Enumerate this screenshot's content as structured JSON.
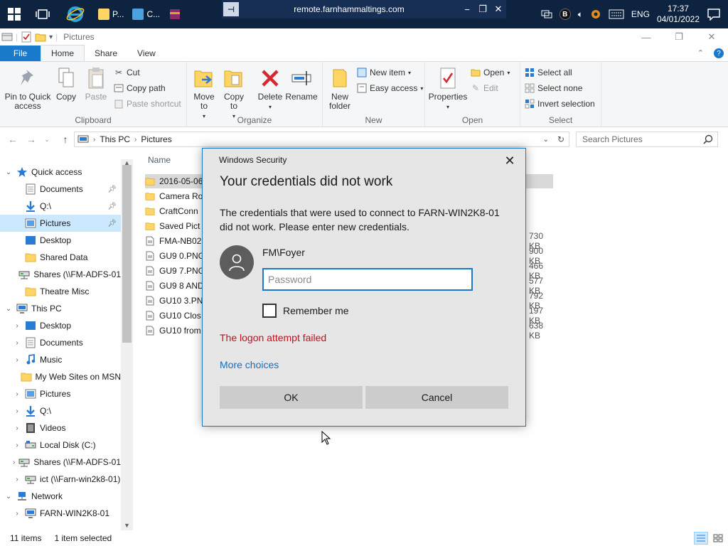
{
  "taskbar": {
    "apps": [
      {
        "label": "P...",
        "icon": "file-explorer-icon"
      },
      {
        "label": "C...",
        "icon": "control-panel-icon"
      }
    ],
    "rdp": {
      "host": "remote.farnhammaltings.com"
    },
    "tray": {
      "language": "ENG",
      "time": "17:37",
      "date": "04/01/2022",
      "badge": "B"
    }
  },
  "explorer": {
    "title": "Pictures",
    "tabs": [
      "File",
      "Home",
      "Share",
      "View"
    ],
    "active_tab": "Home",
    "ribbon": {
      "clipboard": {
        "label": "Clipboard",
        "pin": "Pin to Quick access",
        "copy": "Copy",
        "paste": "Paste",
        "cut": "Cut",
        "copy_path": "Copy path",
        "paste_shortcut": "Paste shortcut"
      },
      "organize": {
        "label": "Organize",
        "move_to": "Move to",
        "copy_to": "Copy to",
        "delete": "Delete",
        "rename": "Rename"
      },
      "new": {
        "label": "New",
        "new_folder": "New folder",
        "new_item": "New item",
        "easy_access": "Easy access"
      },
      "open": {
        "label": "Open",
        "properties": "Properties",
        "open": "Open",
        "edit": "Edit"
      },
      "select": {
        "label": "Select",
        "select_all": "Select all",
        "select_none": "Select none",
        "invert": "Invert selection"
      }
    },
    "address": {
      "crumbs": [
        "This PC",
        "Pictures"
      ]
    },
    "search": {
      "placeholder": "Search Pictures"
    },
    "nav": [
      {
        "label": "Quick access",
        "level": 0,
        "chev": "open",
        "icon": "star-icon"
      },
      {
        "label": "Documents",
        "level": 1,
        "icon": "documents-icon",
        "pinned": true
      },
      {
        "label": "Q:\\",
        "level": 1,
        "icon": "download-icon",
        "pinned": true
      },
      {
        "label": "Pictures",
        "level": 1,
        "icon": "pictures-icon",
        "pinned": true,
        "selected": true
      },
      {
        "label": "Desktop",
        "level": 1,
        "icon": "desktop-icon"
      },
      {
        "label": "Shared Data",
        "level": 1,
        "icon": "folder-icon"
      },
      {
        "label": "Shares (\\\\FM-ADFS-01",
        "level": 1,
        "icon": "network-drive-icon"
      },
      {
        "label": "Theatre Misc",
        "level": 1,
        "icon": "folder-icon"
      },
      {
        "label": "This PC",
        "level": 0,
        "chev": "open",
        "icon": "computer-icon"
      },
      {
        "label": "Desktop",
        "level": 1,
        "chev": "closed",
        "icon": "desktop-icon"
      },
      {
        "label": "Documents",
        "level": 1,
        "chev": "closed",
        "icon": "documents-icon"
      },
      {
        "label": "Music",
        "level": 1,
        "chev": "closed",
        "icon": "music-icon"
      },
      {
        "label": "My Web Sites on MSN",
        "level": 1,
        "icon": "folder-icon"
      },
      {
        "label": "Pictures",
        "level": 1,
        "chev": "closed",
        "icon": "pictures-icon"
      },
      {
        "label": "Q:\\",
        "level": 1,
        "chev": "closed",
        "icon": "download-icon"
      },
      {
        "label": "Videos",
        "level": 1,
        "chev": "closed",
        "icon": "videos-icon"
      },
      {
        "label": "Local Disk (C:)",
        "level": 1,
        "chev": "closed",
        "icon": "disk-icon"
      },
      {
        "label": "Shares (\\\\FM-ADFS-01",
        "level": 1,
        "chev": "closed",
        "icon": "network-drive-icon"
      },
      {
        "label": "ict (\\\\Farn-win2k8-01)",
        "level": 1,
        "chev": "closed",
        "icon": "network-drive-icon"
      },
      {
        "label": "Network",
        "level": 0,
        "chev": "open",
        "icon": "network-icon"
      },
      {
        "label": "FARN-WIN2K8-01",
        "level": 1,
        "chev": "closed",
        "icon": "computer-icon"
      }
    ],
    "files": {
      "column_name": "Name",
      "rows": [
        {
          "name": "2016-05-06",
          "type": "folder",
          "size": "",
          "selected": true
        },
        {
          "name": "Camera Ro",
          "type": "folder",
          "size": ""
        },
        {
          "name": "CraftConn",
          "type": "folder",
          "size": ""
        },
        {
          "name": "Saved Pict",
          "type": "folder",
          "size": ""
        },
        {
          "name": "FMA-NB02",
          "type": "file",
          "size": "730 KB"
        },
        {
          "name": "GU9 0.PNG",
          "type": "file",
          "size": "900 KB"
        },
        {
          "name": "GU9 7.PNG",
          "type": "file",
          "size": "466 KB"
        },
        {
          "name": "GU9 8 AND",
          "type": "file",
          "size": "577 KB"
        },
        {
          "name": "GU10 3.PN",
          "type": "file",
          "size": "792 KB"
        },
        {
          "name": "GU10 Clos",
          "type": "file",
          "size": "197 KB"
        },
        {
          "name": "GU10 from",
          "type": "file",
          "size": "638 KB"
        }
      ]
    },
    "status": {
      "items": "11 items",
      "selected": "1 item selected"
    }
  },
  "dialog": {
    "caption": "Windows Security",
    "heading": "Your credentials did not work",
    "message": "The credentials that were used to connect to FARN-WIN2K8-01 did not work. Please enter new credentials.",
    "username": "FM\\Foyer",
    "password_placeholder": "Password",
    "remember": "Remember me",
    "error": "The logon attempt failed",
    "more_choices": "More choices",
    "ok": "OK",
    "cancel": "Cancel"
  },
  "colors": {
    "accent": "#1979ca",
    "error": "#c50f1f",
    "taskbar": "#0d2340",
    "folder": "#ffd666"
  }
}
